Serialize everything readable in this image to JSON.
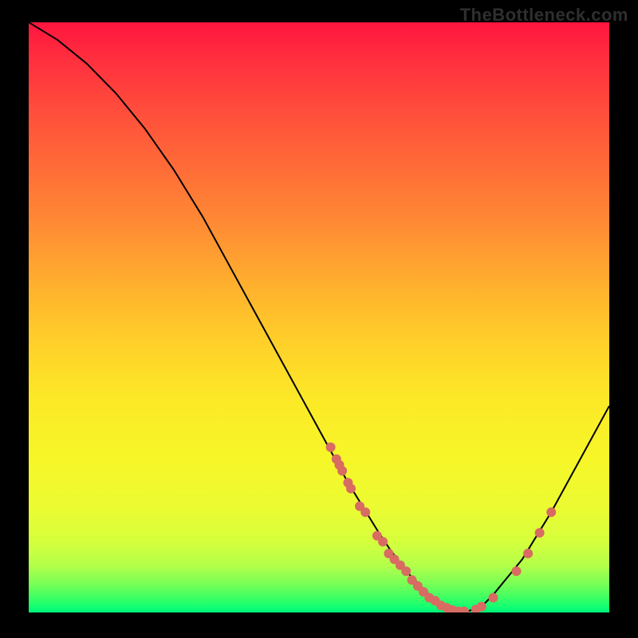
{
  "watermark": "TheBottleneck.com",
  "chart_data": {
    "type": "line",
    "title": "",
    "xlabel": "",
    "ylabel": "",
    "xlim": [
      0,
      100
    ],
    "ylim": [
      0,
      100
    ],
    "grid": false,
    "series": [
      {
        "name": "bottleneck-curve",
        "x": [
          0,
          5,
          10,
          15,
          20,
          25,
          30,
          35,
          40,
          45,
          50,
          55,
          60,
          62,
          65,
          68,
          70,
          72,
          75,
          78,
          80,
          85,
          90,
          95,
          100
        ],
        "y": [
          100,
          97,
          93,
          88,
          82,
          75,
          67,
          58,
          49,
          40,
          31,
          22,
          14,
          11,
          7,
          4,
          2,
          1,
          0,
          1,
          3,
          9,
          17,
          26,
          35
        ],
        "style": {
          "color": "#000000",
          "width": 2
        }
      }
    ],
    "scatter_points": {
      "name": "highlighted-points",
      "color": "#d86b62",
      "points": [
        {
          "x": 52,
          "y": 28
        },
        {
          "x": 53,
          "y": 26
        },
        {
          "x": 53.5,
          "y": 25
        },
        {
          "x": 54,
          "y": 24
        },
        {
          "x": 55,
          "y": 22
        },
        {
          "x": 55.5,
          "y": 21
        },
        {
          "x": 57,
          "y": 18
        },
        {
          "x": 58,
          "y": 17
        },
        {
          "x": 60,
          "y": 13
        },
        {
          "x": 61,
          "y": 12
        },
        {
          "x": 62,
          "y": 10
        },
        {
          "x": 63,
          "y": 9
        },
        {
          "x": 64,
          "y": 8
        },
        {
          "x": 65,
          "y": 7
        },
        {
          "x": 66,
          "y": 5.5
        },
        {
          "x": 67,
          "y": 4.5
        },
        {
          "x": 68,
          "y": 3.5
        },
        {
          "x": 69,
          "y": 2.5
        },
        {
          "x": 70,
          "y": 2
        },
        {
          "x": 71,
          "y": 1.2
        },
        {
          "x": 72,
          "y": 0.8
        },
        {
          "x": 73,
          "y": 0.4
        },
        {
          "x": 74,
          "y": 0.2
        },
        {
          "x": 75,
          "y": 0.2
        },
        {
          "x": 77,
          "y": 0.5
        },
        {
          "x": 78,
          "y": 1
        },
        {
          "x": 80,
          "y": 2.5
        },
        {
          "x": 84,
          "y": 7
        },
        {
          "x": 86,
          "y": 10
        },
        {
          "x": 88,
          "y": 13.5
        },
        {
          "x": 90,
          "y": 17
        }
      ]
    },
    "background_gradient": {
      "orientation": "vertical",
      "stops": [
        {
          "pos": 0,
          "color": "#ff153e"
        },
        {
          "pos": 0.14,
          "color": "#ff4a3c"
        },
        {
          "pos": 0.34,
          "color": "#ff8a34"
        },
        {
          "pos": 0.54,
          "color": "#ffcf2a"
        },
        {
          "pos": 0.74,
          "color": "#f6f628"
        },
        {
          "pos": 0.88,
          "color": "#d5ff3c"
        },
        {
          "pos": 0.95,
          "color": "#7cff55"
        },
        {
          "pos": 1.0,
          "color": "#00f07a"
        }
      ]
    }
  }
}
